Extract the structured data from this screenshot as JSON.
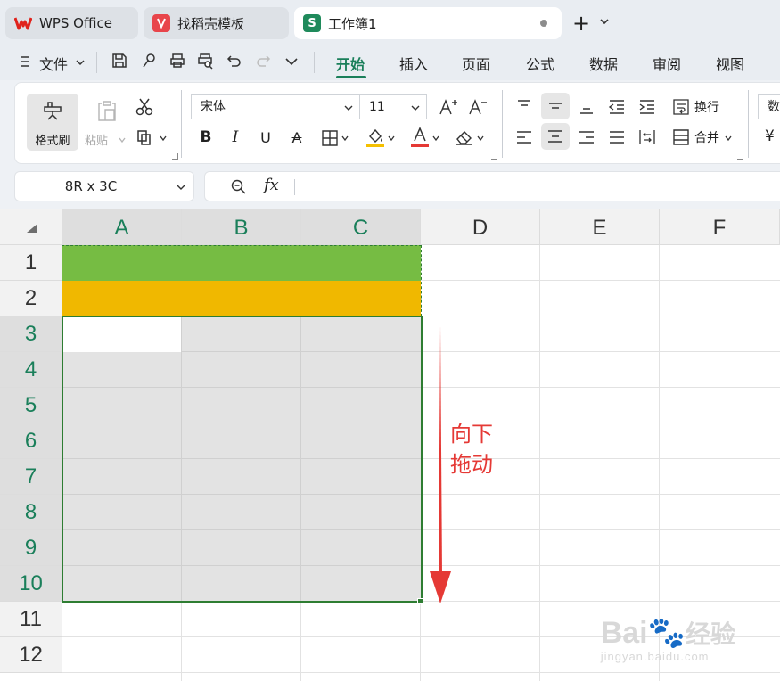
{
  "tabs": [
    {
      "label": "WPS Office",
      "icon": "wps-logo-icon"
    },
    {
      "label": "找稻壳模板",
      "icon": "docer-logo-icon"
    },
    {
      "label": "工作簿1",
      "icon": "spreadsheet-logo-icon",
      "logo_text": "S"
    }
  ],
  "menu": {
    "file": "文件",
    "items": [
      "开始",
      "插入",
      "页面",
      "公式",
      "数据",
      "审阅",
      "视图"
    ],
    "active": "开始"
  },
  "ribbon": {
    "format_painter": "格式刷",
    "paste": "粘贴",
    "font_name": "宋体",
    "font_size": "11",
    "wrap": "换行",
    "merge": "合并",
    "number_cut": "数"
  },
  "formula_bar": {
    "namebox": "8R x 3C",
    "fx": "fx"
  },
  "grid": {
    "columns": [
      "A",
      "B",
      "C",
      "D",
      "E",
      "F"
    ],
    "rows": [
      "1",
      "2",
      "3",
      "4",
      "5",
      "6",
      "7",
      "8",
      "9",
      "10",
      "11",
      "12"
    ]
  },
  "annotation": {
    "line1": "向下",
    "line2": "拖动"
  },
  "watermark": {
    "brand": "Bai",
    "brand_cn": "经验",
    "url": "jingyan.baidu.com"
  },
  "colors": {
    "accent": "#1a7f5a",
    "row1_fill": "#76bc43",
    "row2_fill": "#f0b800",
    "selection_border": "#2e7d32",
    "annotation": "#e53935"
  }
}
